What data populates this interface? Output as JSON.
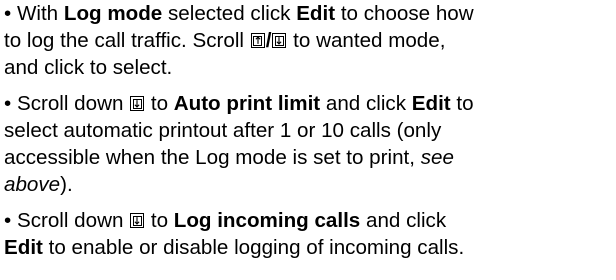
{
  "bullet": "•",
  "icons": {
    "up": "scroll-up-key-icon",
    "down": "scroll-down-key-icon"
  },
  "p1": {
    "l1_a": "With ",
    "l1_b": "Log mode",
    "l1_c": " selected click ",
    "l1_d": "Edit",
    "l1_e": " to choose how",
    "l2_a": "to log the call traffic. Scroll ",
    "l2_slash": "/",
    "l2_b": " to wanted mode,",
    "l3": "and click to select."
  },
  "p2": {
    "l1_a": "Scroll down ",
    "l1_b": " to ",
    "l1_c": "Auto print limit",
    "l1_d": " and click ",
    "l1_e": "Edit",
    "l1_f": " to",
    "l2": "select automatic printout after 1 or 10 calls (only",
    "l3_a": "accessible when the Log mode is set to print, ",
    "l3_b": "see",
    "l4_a": "above",
    "l4_b": ")."
  },
  "p3": {
    "l1_a": "Scroll down ",
    "l1_b": " to ",
    "l1_c": "Log incoming calls",
    "l1_d": " and click",
    "l2_a": "Edit",
    "l2_b": " to enable or disable logging of incoming calls."
  }
}
